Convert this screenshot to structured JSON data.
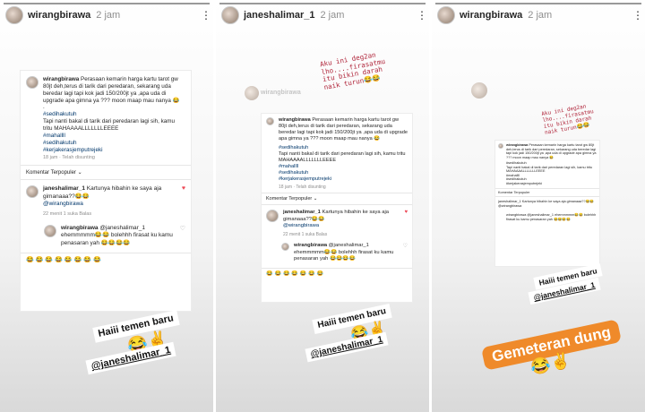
{
  "stories": [
    {
      "header": {
        "username": "wirangbirawa",
        "time": "2 jam"
      },
      "post": {
        "username": "wirangbirawa",
        "text": "Perasaan kemarin harga kartu tarot gw 80jt deh,terus di tarik dari peredaran, sekarang uda beredar lagi tapi kok jadi 150/200jt ya ,apa uda di upgrade apa gimna ya ??? moon maap mau nanya 😂",
        "dot": ".",
        "hashtag1": "#sedihakutuh",
        "line2": "Tapi nanti bakal di tarik dari peredaran lagi sih, kamu tritu MAHAAAALLLLLLLEEEE",
        "tags": "#mahallll\n#sedihakutuh\n#kerjakerasjemputrejeki",
        "meta": "18 jam · Telah disunting"
      },
      "sort_label": "Komentar Terpopuler ⌄",
      "comment1": {
        "username": "janeshalimar_1",
        "text": "Kartunya hibahin ke saya aja gimanaaa??😂😂",
        "mention": "@wirangbirawa",
        "meta": "22 menit   1 suka   Balas"
      },
      "comment2": {
        "username": "wirangbirawa",
        "text": "@janeshalimar_1 ehemmmmm😂😂 bolehhh firasat ku kamu penasaran yah 😂😂😂😂",
        "meta": ""
      },
      "emoji_row": "😂😂😂😂😂😂😂😂",
      "sticker": "Haiii temen baru",
      "sticker_emoji": "😂✌",
      "mention": "@janeshalimar_1"
    },
    {
      "header": {
        "username": "janeshalimar_1",
        "time": "2 jam"
      },
      "overlay": "Aku ini deg2an\nlho....firasatmu\nitu bikin darah\nnaik turun😂😂",
      "blur_name": "wirangbirawa",
      "post": {
        "username": "wirangbirawa",
        "text": "Perasaan kemarin harga kartu tarot gw 80jt deh,terus di tarik dari peredaran, sekarang uda beredar lagi tapi kok jadi 150/200jt ya ,apa uda di upgrade apa gimna ya ??? moon maap mau nanya 😂",
        "hashtag1": "#sedihakutuh",
        "line2": "Tapi nanti bakal di tarik dari peredaran lagi sih, kamu tritu MAHAAAALLLLLLLEEEE",
        "tags": "#mahallll\n#sedihakutuh\n#kerjakerasjemputrejeki",
        "meta": "18 jam · Telah disunting"
      },
      "sort_label": "Komentar Terpopuler ⌄",
      "comment1": {
        "username": "janeshalimar_1",
        "text": "Kartunya hibahin ke saya aja gimanaaa??😂😂",
        "mention": "@wirangbirawa",
        "meta": "22 menit   1 suka   Balas"
      },
      "comment2": {
        "username": "wirangbirawa",
        "text": "@janeshalimar_1 ehemmmmm😂😂 bolehhh firasat ku kamu penasaran yah 😂😂😂😂"
      },
      "emoji_row": "😂😂😂😂😂😂😂",
      "sticker": "Haiii temen baru",
      "sticker_emoji": "😂✌",
      "mention": "@janeshalimar_1"
    },
    {
      "header": {
        "username": "wirangbirawa",
        "time": "2 jam"
      },
      "overlay": "Aku ini deg2an\nlho....firasatmu\nitu bikin darah\nnaik turun😂😂",
      "post_username": "wirangbirawa",
      "post_text": "Perasaan kemarin harga kartu tarot gw 80jt deh,terus di tarik dari peredaran, sekarang uda beredar lagi tapi kok jadi 150/200jt ya ,apa uda di upgrade apa gimna ya ??? moon maap mau nanya 😂",
      "post_line2": "#sedihakutuh\nTapi nanti bakal di tarik dari peredaran lagi sih, kamu tritu MAHAAAALLLLLLLEEEE\n#mahallll\n#sedihakutuh\n#kerjakerasjemputrejeki",
      "sort_label": "Komentar Terpopuler",
      "comment1": "janeshalimar_1 Kartunya hibahin ke saya aja gimanaaa??😂😂 @wirangbirawa",
      "comment2": "wirangbirawa @janeshalimar_1 ehemmmmm😂😂 bolehhh firasat ku kamu penasaran yah 😂😂😂😂",
      "sticker": "Haiii temen baru",
      "mention": "@janeshalimar_1",
      "orange_sticker": "Gemeteran dung",
      "sticker_emoji": "😂✌"
    }
  ]
}
